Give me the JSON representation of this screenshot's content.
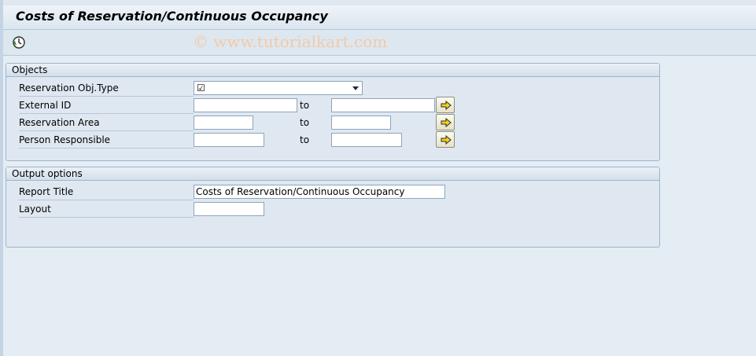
{
  "window": {
    "title": "Costs of Reservation/Continuous Occupancy"
  },
  "toolbar": {
    "execute_icon": "execute-clock-icon"
  },
  "watermark": "© www.tutorialkart.com",
  "objects": {
    "header": "Objects",
    "reservation_obj_type": {
      "label": "Reservation Obj.Type",
      "value": "☑"
    },
    "external_id": {
      "label": "External ID",
      "from": "",
      "to_label": "to",
      "to": ""
    },
    "reservation_area": {
      "label": "Reservation Area",
      "from": "",
      "to_label": "to",
      "to": ""
    },
    "person_responsible": {
      "label": "Person Responsible",
      "from": "",
      "to_label": "to",
      "to": ""
    }
  },
  "output_options": {
    "header": "Output options",
    "report_title": {
      "label": "Report Title",
      "value": "Costs of Reservation/Continuous Occupancy"
    },
    "layout": {
      "label": "Layout",
      "value": ""
    }
  },
  "colors": {
    "background": "#dfe8f1",
    "multi_button": "#e5e2c9",
    "arrow": "#f2d21a"
  }
}
